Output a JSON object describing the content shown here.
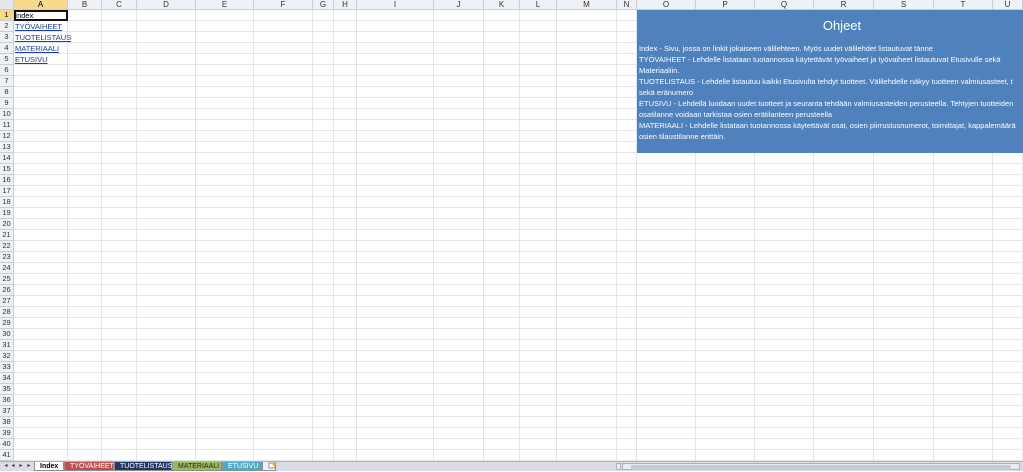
{
  "sheet": {
    "columns": [
      "A",
      "B",
      "C",
      "D",
      "E",
      "F",
      "G",
      "H",
      "I",
      "J",
      "K",
      "L",
      "M",
      "N",
      "O",
      "P",
      "Q",
      "R",
      "S",
      "T",
      "U"
    ],
    "selected_column": "A",
    "rows": [
      "1",
      "2",
      "3",
      "4",
      "5",
      "6",
      "7",
      "8",
      "9",
      "10",
      "11",
      "12",
      "13",
      "14",
      "15",
      "16",
      "17",
      "18",
      "19",
      "20",
      "21",
      "22",
      "23",
      "24",
      "25",
      "26",
      "27",
      "28",
      "29",
      "30",
      "31",
      "32",
      "33",
      "34",
      "35",
      "36",
      "37",
      "38",
      "39",
      "40",
      "41"
    ],
    "selected_row": "1",
    "cells": {
      "a1": "Index",
      "a2": "TYÖVAIHEET",
      "a3": "TUOTELISTAUS",
      "a4": "MATERIAALI",
      "a5": "ETUSIVU"
    }
  },
  "info_box": {
    "title": "Ohjeet",
    "lines": [
      "Index - Sivu, jossa on linkit jokaiseen välilehteen. Myös uudet välilehdet listautuvat tänne",
      "TYÖVAIHEET - Lehdelle listataan tuotannossa käytettävät työvaiheet ja työvaiheet listautuvat Etusivulle sekä",
      "Materiaaliin.",
      "TUOTELISTAUS - Lehdelle listautuu kaikki Etusivulta tehdyt tuotteet. Välilehdelle näkyy tuotteen valmiusasteet, t",
      "sekä eränumero",
      "ETUSIVU - Lehdellä luodaan uudet tuotteet ja seuranta tehdään valmiusasteiden perusteella. Tehtyjen tuotteiden",
      "osatilanne voidaan tarkistaa osien erätilanteen perusteella",
      "MATERIAALI - Lehdelle listataan tuotannossa käytettävät osat, osien piirrustusnumerot, toimittajat, kappalemäärä",
      "osien tilaustilanne erittäin."
    ],
    "background": "#4f81bd"
  },
  "tabs": {
    "nav_first": "◂",
    "nav_prev": "◂",
    "nav_next": "▸",
    "nav_last": "▸",
    "items": [
      {
        "label": "Index",
        "color": "#ffffff"
      },
      {
        "label": "TYÖVAIHEET",
        "color": "#c0504d"
      },
      {
        "label": "TUOTELISTAUS",
        "color": "#1f3864"
      },
      {
        "label": "MATERIAALI",
        "color": "#9bbb59"
      },
      {
        "label": "ETUSIVU",
        "color": "#4bacc6"
      }
    ],
    "new_sheet_icon": "new-sheet-icon"
  }
}
